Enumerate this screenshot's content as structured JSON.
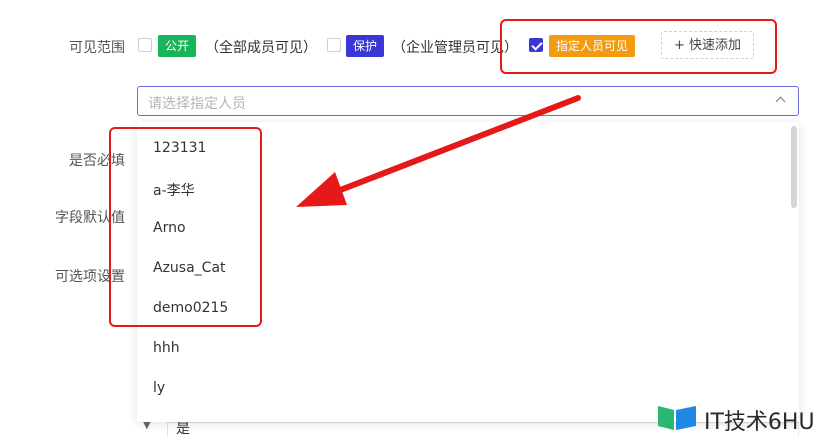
{
  "form": {
    "visibility_label": "可见范围",
    "required_label": "是否必填",
    "default_label": "字段默认值",
    "options_label": "可选项设置"
  },
  "visibility": {
    "public_tag": "公开",
    "public_desc": "（全部成员可见）",
    "protected_tag": "保护",
    "protected_desc": "（企业管理员可见）",
    "specified_tag": "指定人员可见",
    "quick_add": "+ 快速添加",
    "public_checked": false,
    "protected_checked": false,
    "specified_checked": true
  },
  "colors": {
    "public_tag": "#19b35a",
    "protected_tag": "#3b36d6",
    "specified_tag": "#f29b11",
    "annotation": "#e51919"
  },
  "select": {
    "placeholder": "请选择指定人员",
    "options": [
      "123131",
      "a-李华",
      "Arno",
      "Azusa_Cat",
      "demo0215",
      "hhh",
      "ly"
    ]
  },
  "bottom_field": {
    "value": "是"
  },
  "watermark": {
    "text": "IT技术6HU"
  }
}
